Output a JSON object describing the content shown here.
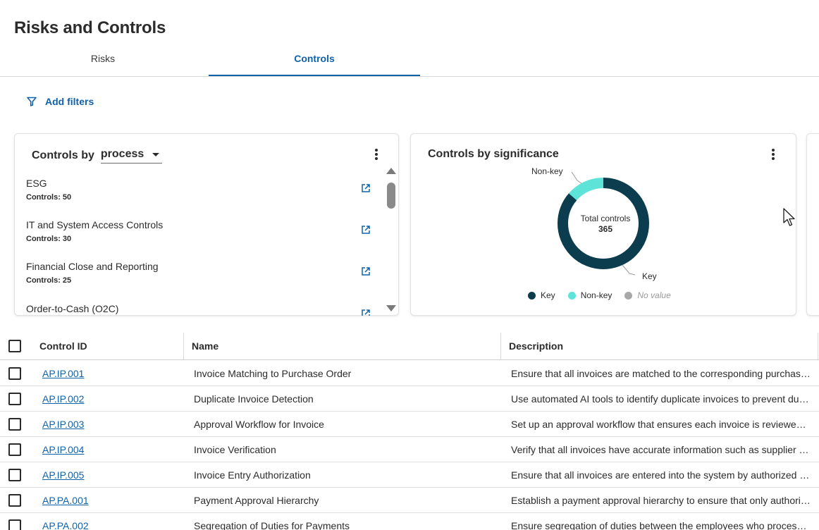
{
  "page": {
    "title": "Risks and Controls"
  },
  "tabs": [
    {
      "label": "Risks"
    },
    {
      "label": "Controls"
    }
  ],
  "filters": {
    "label": "Add filters",
    "icon": "filter-icon"
  },
  "process_card": {
    "title_prefix": "Controls by",
    "dropdown_value": "process",
    "count_label": "Controls:",
    "items": [
      {
        "name": "ESG",
        "count": "50"
      },
      {
        "name": "IT and System Access Controls",
        "count": "30"
      },
      {
        "name": "Financial Close and Reporting",
        "count": "25"
      },
      {
        "name": "Order-to-Cash (O2C)",
        "count": ""
      }
    ]
  },
  "significance_card": {
    "title": "Controls by significance",
    "center_label": "Total controls",
    "center_value": "365",
    "callouts": {
      "nonkey": "Non-key",
      "key": "Key"
    },
    "legend": [
      {
        "label": "Key",
        "color": "#0b3d4f"
      },
      {
        "label": "Non-key",
        "color": "#5ee3d8"
      },
      {
        "label": "No value",
        "color": "#a8a8a8"
      }
    ]
  },
  "chart_data": {
    "type": "pie",
    "title": "Controls by significance",
    "categories": [
      "Key",
      "Non-key",
      "No value"
    ],
    "values": [
      315,
      50,
      0
    ],
    "total": 365,
    "colors": [
      "#0b3d4f",
      "#5ee3d8",
      "#a8a8a8"
    ],
    "legend_position": "bottom"
  },
  "table": {
    "columns": {
      "id": "Control ID",
      "name": "Name",
      "description": "Description"
    },
    "rows": [
      {
        "id": "AP.IP.001",
        "name": "Invoice Matching to Purchase Order",
        "description": "Ensure that all invoices are matched to the corresponding purchase orders"
      },
      {
        "id": "AP.IP.002",
        "name": "Duplicate Invoice Detection",
        "description": "Use automated AI tools to identify duplicate invoices to prevent duplicate payments"
      },
      {
        "id": "AP.IP.003",
        "name": "Approval Workflow for Invoice",
        "description": "Set up an approval workflow that ensures each invoice is reviewed and approved"
      },
      {
        "id": "AP.IP.004",
        "name": "Invoice Verification",
        "description": "Verify that all invoices have accurate information such as supplier details"
      },
      {
        "id": "AP.IP.005",
        "name": "Invoice Entry Authorization",
        "description": "Ensure that all invoices are entered into the system by authorized personnel"
      },
      {
        "id": "AP.PA.001",
        "name": "Payment Approval Hierarchy",
        "description": "Establish a payment approval hierarchy to ensure that only authorized staff"
      },
      {
        "id": "AP.PA.002",
        "name": "Segregation of Duties for Payments",
        "description": "Ensure segregation of duties between the employees who process payments"
      }
    ]
  }
}
